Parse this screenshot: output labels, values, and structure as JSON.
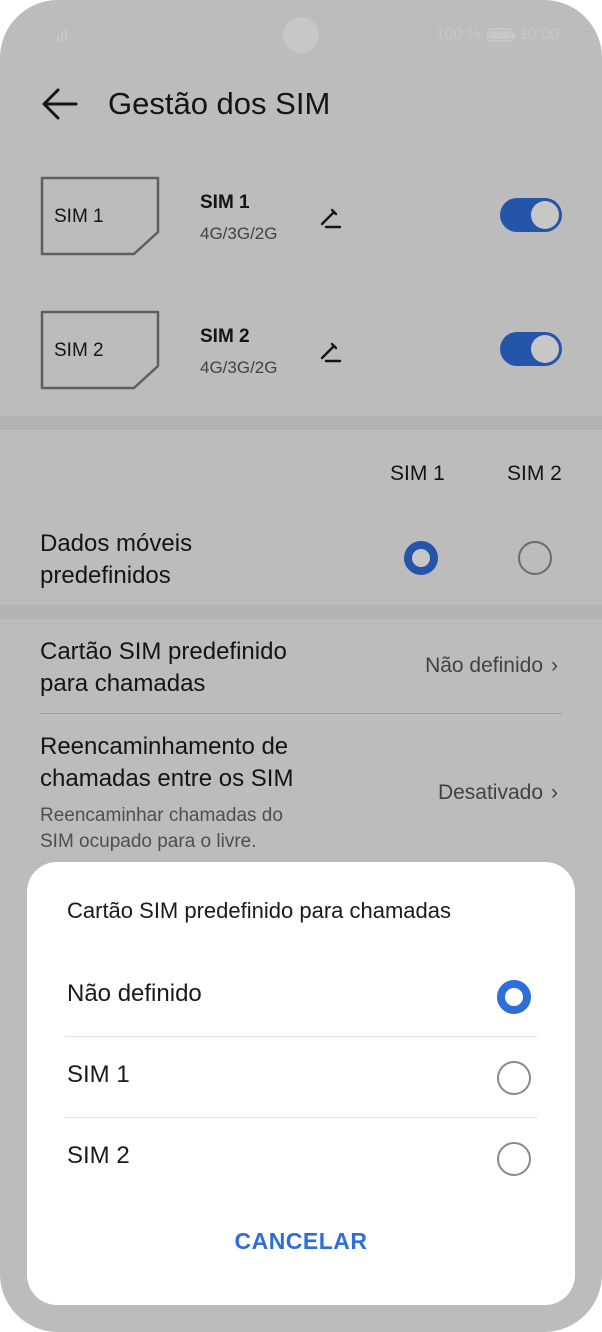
{
  "status_bar": {
    "battery_text": "100 %",
    "time": "10:00"
  },
  "header": {
    "title": "Gestão dos SIM"
  },
  "sims": [
    {
      "card_label": "SIM 1",
      "name": "SIM 1",
      "network": "4G/3G/2G",
      "enabled": true
    },
    {
      "card_label": "SIM 2",
      "name": "SIM 2",
      "network": "4G/3G/2G",
      "enabled": true
    }
  ],
  "columns": {
    "sim1": "SIM 1",
    "sim2": "SIM 2"
  },
  "mobile_data": {
    "label_line1": "Dados móveis",
    "label_line2": "predefinidos",
    "selected": "SIM 1"
  },
  "default_call": {
    "label_line1": "Cartão SIM predefinido",
    "label_line2": "para chamadas",
    "value": "Não definido"
  },
  "forwarding": {
    "label_line1": "Reencaminhamento de",
    "label_line2": "chamadas entre os SIM",
    "desc_line1": "Reencaminhar chamadas do",
    "desc_line2": "SIM ocupado para o livre.",
    "value": "Desativado"
  },
  "dialog": {
    "title": "Cartão SIM predefinido para chamadas",
    "options": [
      {
        "label": "Não definido",
        "selected": true
      },
      {
        "label": "SIM 1",
        "selected": false
      },
      {
        "label": "SIM 2",
        "selected": false
      }
    ],
    "cancel_label": "CANCELAR"
  },
  "colors": {
    "accent": "#2f6ed8",
    "dim_overlay": "rgba(0,0,0,0.22)"
  },
  "icons": {
    "back": "arrow-left-icon",
    "edit": "pencil-icon",
    "chevron": "chevron-right-icon"
  }
}
